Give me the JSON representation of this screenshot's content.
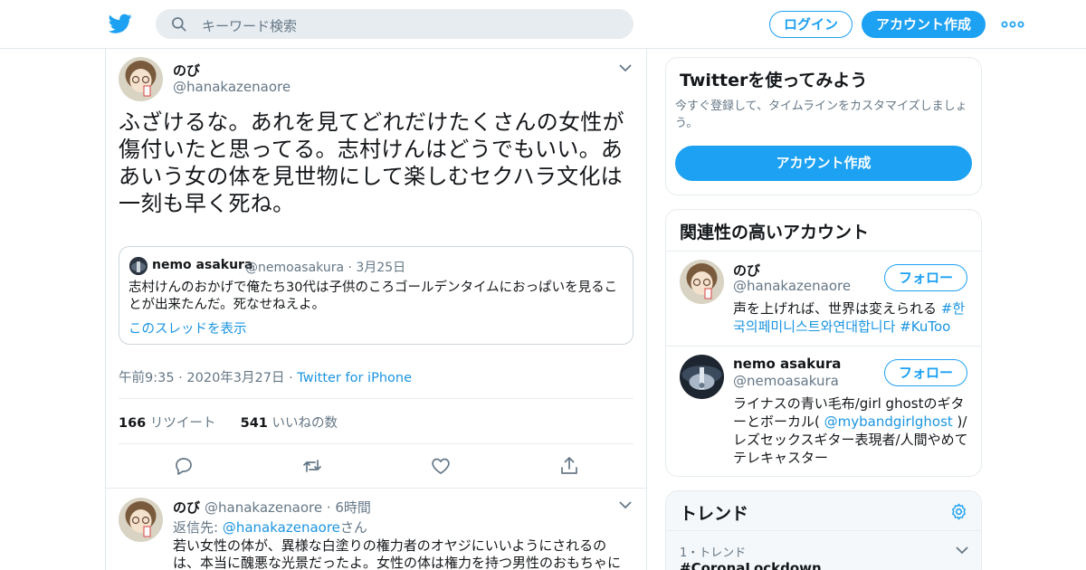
{
  "header": {
    "search_placeholder": "キーワード検索",
    "login_label": "ログイン",
    "signup_label": "アカウント作成",
    "brand_color": "#1da1f2"
  },
  "tweet": {
    "author_name": "のび",
    "author_handle": "@hanakazenaore",
    "body": "ふざけるな。あれを見てどれだけたくさんの女性が傷付いたと思ってる。志村けんはどうでもいい。ああいう女の体を見世物にして楽しむセクハラ文化は一刻も早く死ね。",
    "quote": {
      "name": "nemo asakura",
      "handle": "@nemoasakura",
      "date": "3月25日",
      "text": "志村けんのおかげで俺たち30代は子供のころゴールデンタイムにおっぱいを見ることが出来たんだ。死なせねえよ。",
      "thread_link": "このスレッドを表示"
    },
    "timestamp": "午前9:35 · 2020年3月27日",
    "source": "Twitter for iPhone",
    "retweet_count": "166",
    "retweet_label": "リツイート",
    "like_count": "541",
    "like_label": "いいねの数"
  },
  "reply": {
    "author_name": "のび",
    "author_handle": "@hanakazenaore",
    "time": "6時間",
    "reply_to_prefix": "返信先: ",
    "reply_to_handle": "@hanakazenaore",
    "reply_to_suffix": "さん",
    "body": "若い女性の体が、異様な白塗りの権力者のオヤジにいいようにされるのは、本当に醜悪な光景だったよ。女性の体は権力を持つ男性のおもちゃに"
  },
  "sidebar": {
    "signup_card": {
      "title": "Twitterを使ってみよう",
      "subtitle": "今すぐ登録して、タイムラインをカスタマイズしましょう。",
      "button": "アカウント作成"
    },
    "related": {
      "title": "関連性の高いアカウント",
      "accounts": [
        {
          "name": "のび",
          "handle": "@hanakazenaore",
          "follow": "フォロー",
          "bio_text": "声を上げれば、世界は変えられる ",
          "bio_tags": "#한국의페미니스트와연대합니다 #KuToo"
        },
        {
          "name": "nemo asakura",
          "handle": "@nemoasakura",
          "follow": "フォロー",
          "bio_a": "ライナスの青い毛布/girl ghostのギターとボーカル( ",
          "bio_link": "@mybandgirlghost",
          "bio_b": " )/レズセックスギター表現者/人間やめてテレキャスター"
        }
      ]
    },
    "trends": {
      "title": "トレンド",
      "items": [
        {
          "meta": "1・トレンド",
          "name": "#CoronaLockdown"
        }
      ]
    }
  }
}
